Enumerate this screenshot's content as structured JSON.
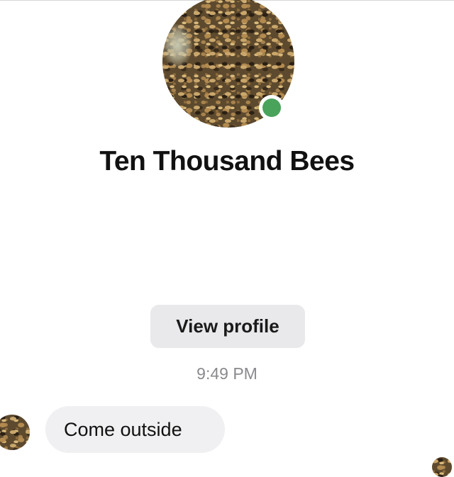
{
  "contact": {
    "name": "Ten Thousand Bees",
    "status": "online",
    "avatar_icon": "bee-swarm-avatar",
    "online_color": "#4aa35b"
  },
  "actions": {
    "view_profile_label": "View profile"
  },
  "conversation": {
    "timestamp": "9:49 PM",
    "messages": [
      {
        "sender": "Ten Thousand Bees",
        "text": "Come outside",
        "direction": "incoming"
      }
    ],
    "read_receipt_icon": "seen-avatar"
  },
  "colors": {
    "bubble_background": "#f0f0f2",
    "button_background": "#e9e9ec",
    "timestamp_text": "#8a8a8e"
  }
}
